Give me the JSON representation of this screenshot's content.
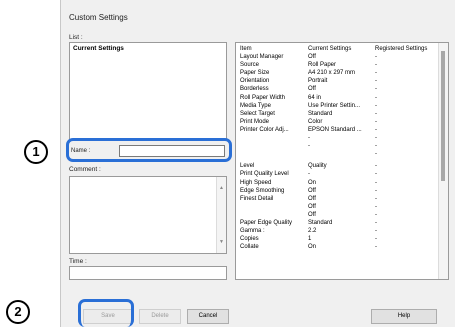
{
  "dialog": {
    "title": "Custom Settings",
    "list_label": "List :",
    "list_items": [
      "Current Settings"
    ],
    "name_label": "Name :",
    "name_value": "",
    "comment_label": "Comment :",
    "time_label": "Time :"
  },
  "settings_table": {
    "headers": [
      "Item",
      "Current Settings",
      "Registered Settings"
    ],
    "rows": [
      {
        "item": "Layout Manager",
        "current": "Off",
        "registered": "-"
      },
      {
        "item": "Source",
        "current": "Roll Paper",
        "registered": "-"
      },
      {
        "item": "Paper Size",
        "current": "A4 210 x 297 mm",
        "registered": "-"
      },
      {
        "item": "Orientation",
        "current": "Portrait",
        "registered": "-"
      },
      {
        "item": "Borderless",
        "current": "Off",
        "registered": "-"
      },
      {
        "item": "Roll Paper Width",
        "current": "64 in",
        "registered": "-"
      },
      {
        "item": "Media Type",
        "current": "Use Printer Settin...",
        "registered": "-"
      },
      {
        "item": "Select Target",
        "current": "Standard",
        "registered": "-"
      },
      {
        "item": "Print Mode",
        "current": "Color",
        "registered": "-"
      },
      {
        "item": "Printer Color Adj...",
        "current": "EPSON Standard ...",
        "registered": "-"
      },
      {
        "item": "",
        "current": "-",
        "registered": "-"
      },
      {
        "item": "",
        "current": "-",
        "registered": "-"
      },
      {
        "item": "",
        "current": "",
        "registered": "-"
      },
      {
        "item": "Level",
        "current": "Quality",
        "registered": "-"
      },
      {
        "item": "Print Quality Level",
        "current": "-",
        "registered": "-"
      },
      {
        "item": "High Speed",
        "current": "On",
        "registered": "-"
      },
      {
        "item": "Edge Smoothing",
        "current": "Off",
        "registered": "-"
      },
      {
        "item": "Finest Detail",
        "current": "Off",
        "registered": "-"
      },
      {
        "item": "",
        "current": "Off",
        "registered": "-"
      },
      {
        "item": "",
        "current": "Off",
        "registered": "-"
      },
      {
        "item": "Paper Edge Quality",
        "current": "Standard",
        "registered": "-"
      },
      {
        "item": "Gamma :",
        "current": "2.2",
        "registered": "-"
      },
      {
        "item": "Copies",
        "current": "1",
        "registered": "-"
      },
      {
        "item": "Collate",
        "current": "On",
        "registered": "-"
      }
    ]
  },
  "buttons": {
    "save": "Save",
    "delete": "Delete",
    "cancel": "Cancel",
    "help": "Help"
  },
  "callouts": {
    "step1": "1",
    "step2": "2"
  },
  "colors": {
    "highlight": "#2a6fd6"
  }
}
